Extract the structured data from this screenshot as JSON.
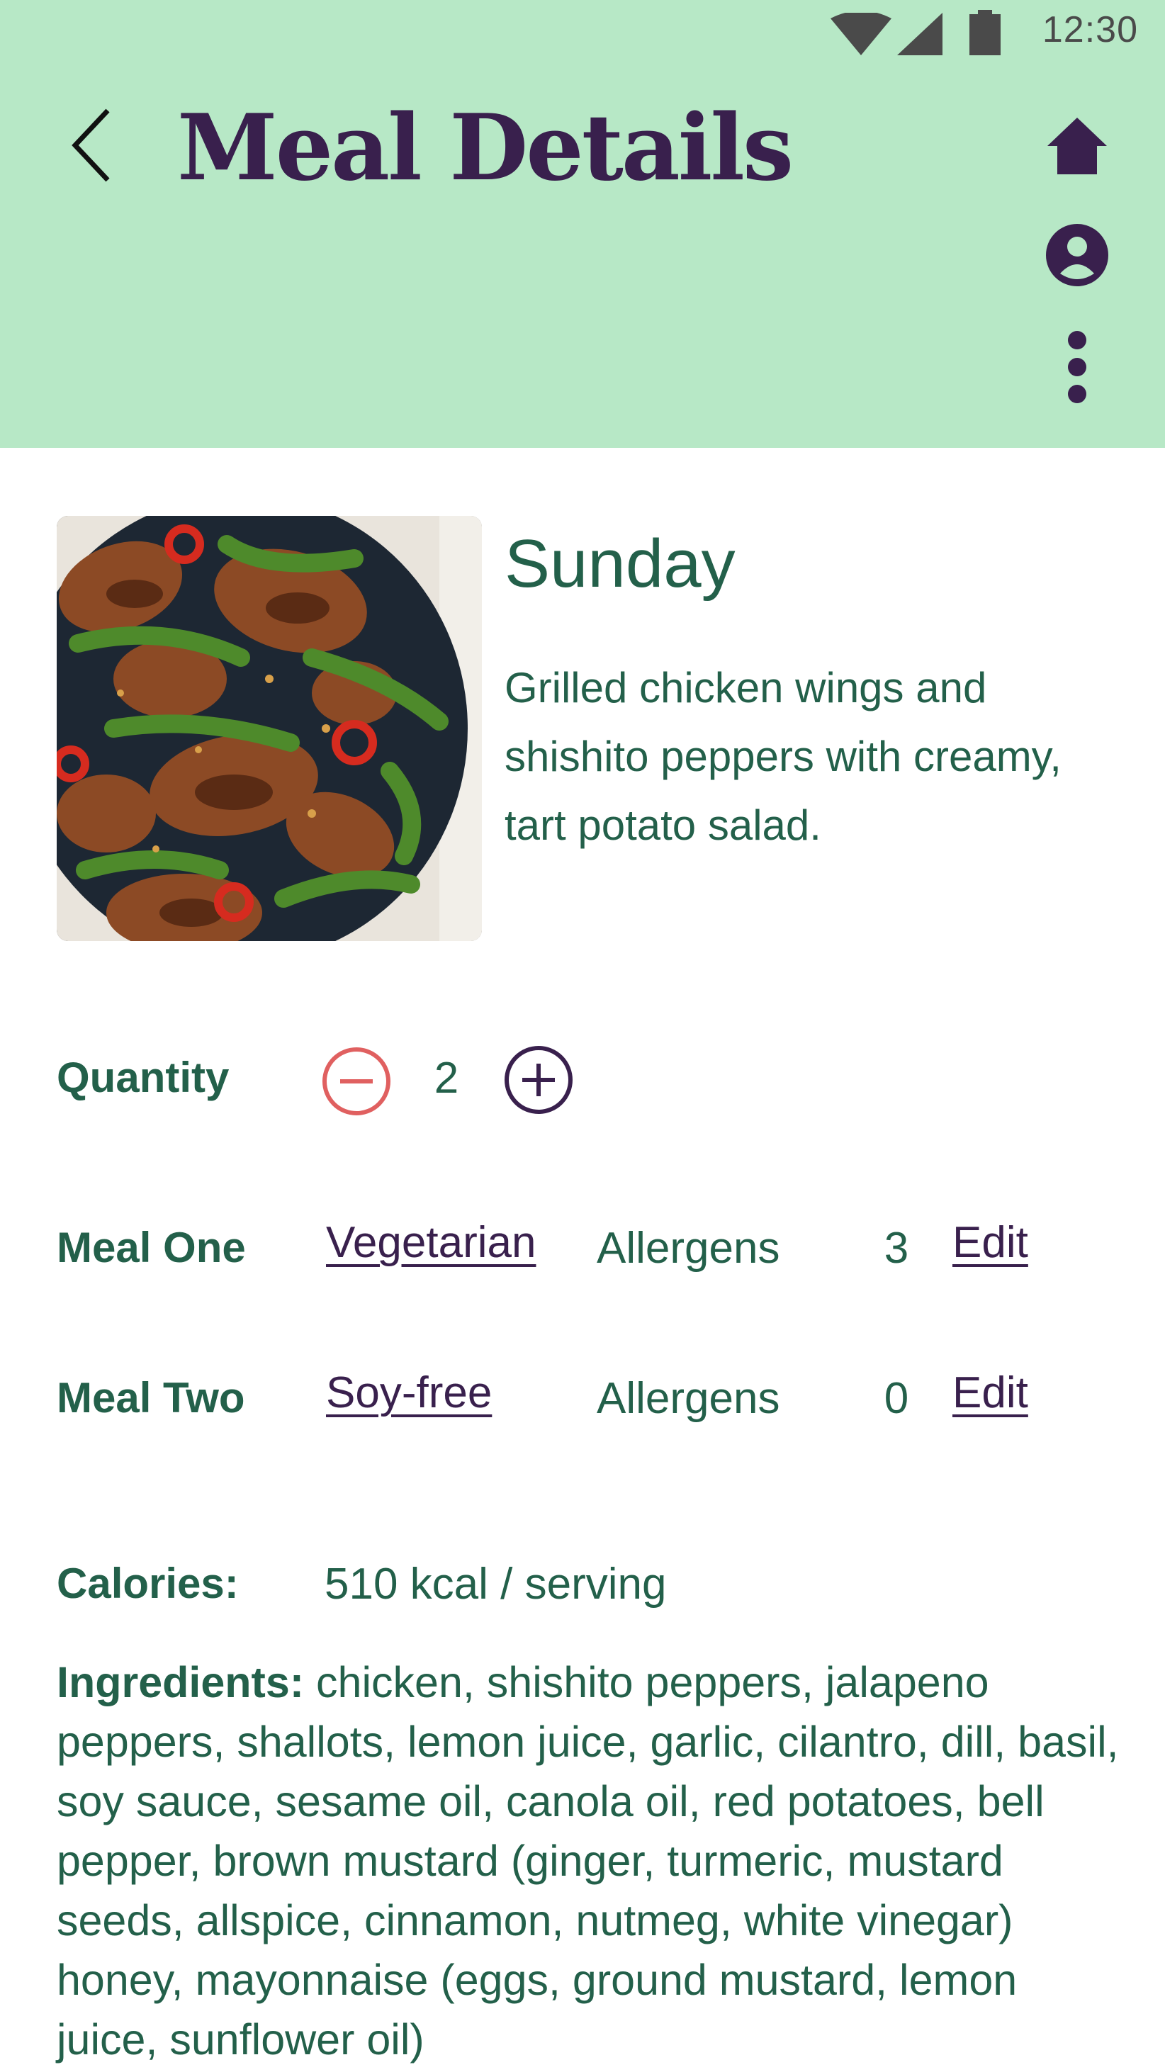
{
  "status_bar": {
    "time": "12:30",
    "icons": [
      "wifi-icon",
      "signal-icon",
      "battery-icon"
    ]
  },
  "app_bar": {
    "title": "Meal Details",
    "back_icon": "chevron-left-icon",
    "actions": [
      "home-icon",
      "account-circle-icon",
      "more-vertical-icon"
    ],
    "background": "#b7e8c6",
    "title_color": "#39204d"
  },
  "meal": {
    "day": "Sunday",
    "description": "Grilled chicken wings and shishito peppers with creamy, tart potato salad.",
    "image": "grilled chicken wings with green shishito peppers and red chili slices on a dark plate"
  },
  "quantity": {
    "label": "Quantity",
    "value": "2",
    "decrement_icon": "minus-circle-icon",
    "increment_icon": "plus-circle-icon"
  },
  "meals": [
    {
      "label": "Meal One",
      "diet": "Vegetarian",
      "allergens_label": "Allergens",
      "allergens_count": "3",
      "edit_label": "Edit"
    },
    {
      "label": "Meal Two",
      "diet": "Soy-free",
      "allergens_label": "Allergens",
      "allergens_count": "0",
      "edit_label": "Edit"
    }
  ],
  "calories": {
    "label": "Calories:",
    "value": "510 kcal / serving"
  },
  "ingredients": {
    "label": "Ingredients:",
    "text": "chicken, shishito peppers, jalapeno peppers, shallots, lemon juice, garlic, cilantro, dill, basil, soy sauce, sesame oil, canola oil, red potatoes, bell pepper, brown mustard (ginger, turmeric, mustard seeds, allspice, cinnamon, nutmeg, white vinegar) honey, mayonnaise (eggs, ground mustard, lemon juice, sunflower oil)"
  },
  "colors": {
    "primary_text": "#23604a",
    "accent": "#39204d",
    "decrement": "#e06060"
  }
}
